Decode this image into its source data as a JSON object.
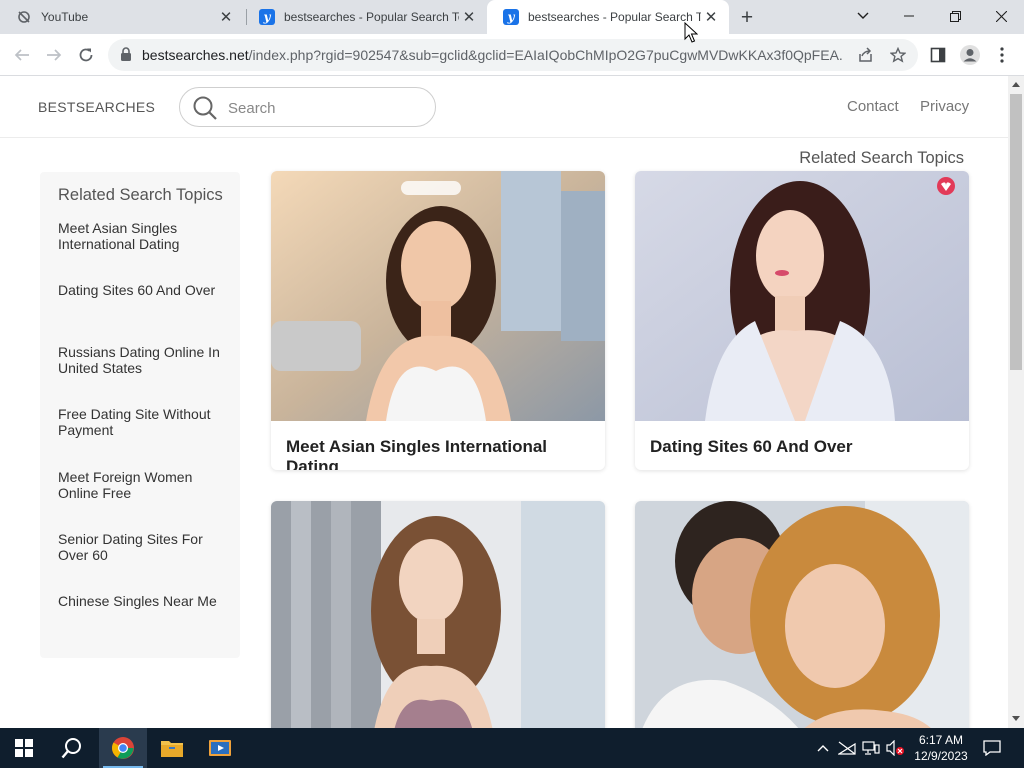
{
  "browser": {
    "tabs": [
      {
        "title": "YouTube",
        "icon": "youtube-offline-icon",
        "active": false
      },
      {
        "title": "bestsearches - Popular Search To",
        "icon": "y-favicon",
        "active": false
      },
      {
        "title": "bestsearches - Popular Search To",
        "icon": "y-favicon",
        "active": true
      }
    ],
    "url_host": "bestsearches.net",
    "url_path": "/index.php?rgid=902547&sub=gclid&gclid=EAIaIQobChMIpO2G7puCgwMVDwKKAx3f0QpFEA..."
  },
  "site": {
    "brand": "BESTSEARCHES",
    "search_placeholder": "Search",
    "nav": [
      "Contact",
      "Privacy"
    ],
    "sidebar_title": "Related Search Topics",
    "sidebar_items": [
      "Meet Asian Singles International Dating",
      "Dating Sites 60 And Over",
      "Russians Dating Online In United States",
      "Free Dating Site Without Payment",
      "Meet Foreign Women Online Free",
      "Senior Dating Sites For Over 60",
      "Chinese Singles Near Me"
    ],
    "main_heading": "Related Search Topics",
    "cards": [
      {
        "caption": "Meet Asian Singles International Dating",
        "image": "woman-city-street-photo"
      },
      {
        "caption": "Dating Sites 60 And Over",
        "image": "woman-portrait-photo"
      },
      {
        "caption": "",
        "image": "woman-window-photo"
      },
      {
        "caption": "",
        "image": "couple-embracing-photo"
      }
    ]
  },
  "taskbar": {
    "apps": [
      "start-icon",
      "search-icon",
      "chrome-icon",
      "file-explorer-icon",
      "media-player-icon"
    ],
    "time": "6:17 AM",
    "date": "12/9/2023"
  },
  "colors": {
    "tabstrip": "#dee1e6",
    "taskbar": "#0f1e2d",
    "favicon_blue": "#1a73e8"
  }
}
